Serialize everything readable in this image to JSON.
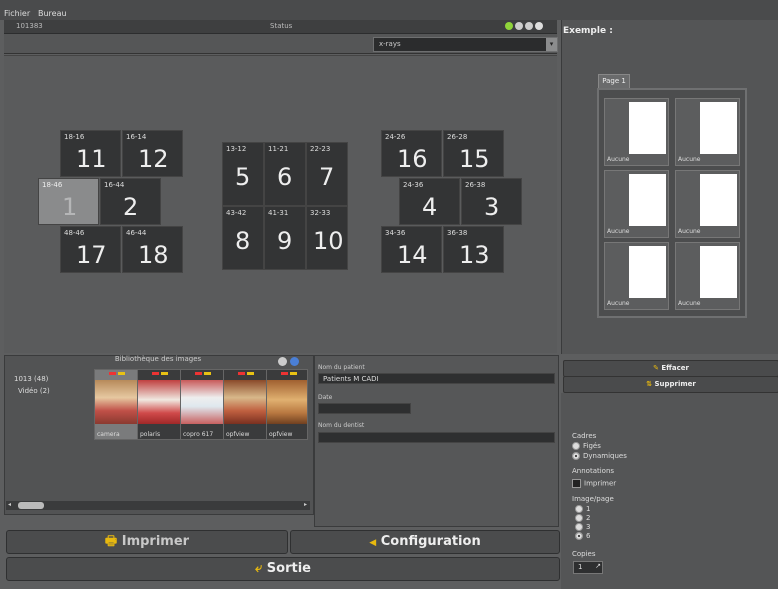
{
  "menu": {
    "file": "Fichier",
    "desk": "Bureau"
  },
  "header": {
    "id": "101383",
    "status_label": "Status"
  },
  "view_select": {
    "value": "x-rays"
  },
  "tiles": [
    {
      "code": "18-16",
      "num": "11",
      "selected": false
    },
    {
      "code": "16-14",
      "num": "12",
      "selected": false
    },
    {
      "code": "18-46",
      "num": "1",
      "selected": true
    },
    {
      "code": "16-44",
      "num": "2",
      "selected": false
    },
    {
      "code": "48-46",
      "num": "17",
      "selected": false
    },
    {
      "code": "46-44",
      "num": "18",
      "selected": false
    },
    {
      "code": "13-12",
      "num": "5",
      "selected": false
    },
    {
      "code": "11-21",
      "num": "6",
      "selected": false
    },
    {
      "code": "22-23",
      "num": "7",
      "selected": false
    },
    {
      "code": "43-42",
      "num": "8",
      "selected": false
    },
    {
      "code": "41-31",
      "num": "9",
      "selected": false
    },
    {
      "code": "32-33",
      "num": "10",
      "selected": false
    },
    {
      "code": "24-26",
      "num": "16",
      "selected": false
    },
    {
      "code": "26-28",
      "num": "15",
      "selected": false
    },
    {
      "code": "24-36",
      "num": "4",
      "selected": false
    },
    {
      "code": "26-38",
      "num": "3",
      "selected": false
    },
    {
      "code": "34-36",
      "num": "14",
      "selected": false
    },
    {
      "code": "36-38",
      "num": "13",
      "selected": false
    }
  ],
  "example": {
    "title": "Exemple :",
    "tab": "Page 1",
    "slot_label": "Aucune"
  },
  "library": {
    "title": "Bibliothèque des images",
    "folders": [
      "1013 (48)",
      "Vidéo (2)"
    ],
    "thumbs": [
      {
        "caption": "camera"
      },
      {
        "caption": "polaris"
      },
      {
        "caption": "copro 617"
      },
      {
        "caption": "opfview"
      },
      {
        "caption": "opfview"
      }
    ]
  },
  "form": {
    "patient_label": "Nom du patient",
    "patient_value": "Patients M CADI",
    "date_label": "Date",
    "date_value": "",
    "dentist_label": "Nom du dentist",
    "dentist_value": ""
  },
  "side_buttons": {
    "clear": "Effacer",
    "delete": "Supprimer"
  },
  "options": {
    "frames_title": "Cadres",
    "frames": [
      "Figés",
      "Dynamiques"
    ],
    "annotations_title": "Annotations",
    "print_label": "Imprimer",
    "per_page_title": "Image/page",
    "per_page": [
      "1",
      "2",
      "3",
      "6"
    ],
    "copies_title": "Copies",
    "copies_value": "1"
  },
  "actions": {
    "print": "Imprimer",
    "config": "Configuration",
    "exit": "Sortie"
  },
  "colors": {
    "yellow_icon": "#e8b90f",
    "bg": "#5d5e5f"
  }
}
